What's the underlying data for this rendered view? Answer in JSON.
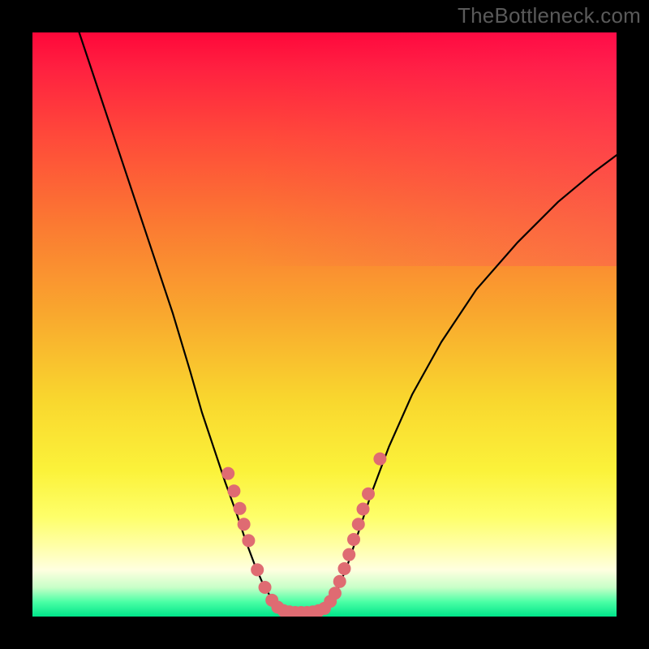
{
  "watermark": "TheBottleneck.com",
  "colors": {
    "background": "#000000",
    "curve": "#000000",
    "marker": "#df6b72",
    "gradient_top": "#ff073a",
    "gradient_mid": "#f9d72e",
    "gradient_bottom": "#00e58a"
  },
  "chart_data": {
    "type": "line",
    "title": "",
    "xlabel": "",
    "ylabel": "",
    "xlim": [
      0,
      100
    ],
    "ylim": [
      0,
      100
    ],
    "series": [
      {
        "name": "left-curve",
        "x": [
          8,
          12,
          16,
          20,
          24,
          27,
          29,
          31,
          33,
          35,
          36.5,
          38,
          39.5,
          41,
          42,
          43
        ],
        "y": [
          100,
          88,
          76,
          64,
          52,
          42,
          35,
          29,
          23,
          17.5,
          13,
          9,
          5.5,
          3,
          1.5,
          0.8
        ]
      },
      {
        "name": "flat-bottom",
        "x": [
          43,
          44,
          45,
          46,
          47,
          48,
          49,
          50
        ],
        "y": [
          0.8,
          0.6,
          0.5,
          0.5,
          0.5,
          0.6,
          0.8,
          1.2
        ]
      },
      {
        "name": "right-curve",
        "x": [
          50,
          52,
          54,
          56,
          58,
          61,
          65,
          70,
          76,
          83,
          90,
          96,
          100
        ],
        "y": [
          1.2,
          4,
          9,
          15,
          21,
          29,
          38,
          47,
          56,
          64,
          71,
          76,
          79
        ]
      }
    ],
    "markers": {
      "name": "highlight-dots",
      "color": "#df6b72",
      "radius_px": 8,
      "points_xy": [
        [
          33.5,
          24.5
        ],
        [
          34.5,
          21.5
        ],
        [
          35.5,
          18.5
        ],
        [
          36.2,
          15.8
        ],
        [
          37.0,
          13.0
        ],
        [
          38.5,
          8.0
        ],
        [
          39.8,
          5.0
        ],
        [
          41.0,
          2.8
        ],
        [
          42.0,
          1.6
        ],
        [
          43.0,
          1.0
        ],
        [
          44.0,
          0.8
        ],
        [
          45.0,
          0.7
        ],
        [
          46.0,
          0.7
        ],
        [
          47.0,
          0.7
        ],
        [
          48.0,
          0.8
        ],
        [
          49.0,
          1.0
        ],
        [
          50.0,
          1.4
        ],
        [
          51.0,
          2.6
        ],
        [
          51.8,
          4.0
        ],
        [
          52.6,
          6.0
        ],
        [
          53.4,
          8.2
        ],
        [
          54.2,
          10.6
        ],
        [
          55.0,
          13.2
        ],
        [
          55.8,
          15.8
        ],
        [
          56.6,
          18.4
        ],
        [
          57.5,
          21.0
        ],
        [
          59.5,
          27.0
        ]
      ]
    }
  }
}
